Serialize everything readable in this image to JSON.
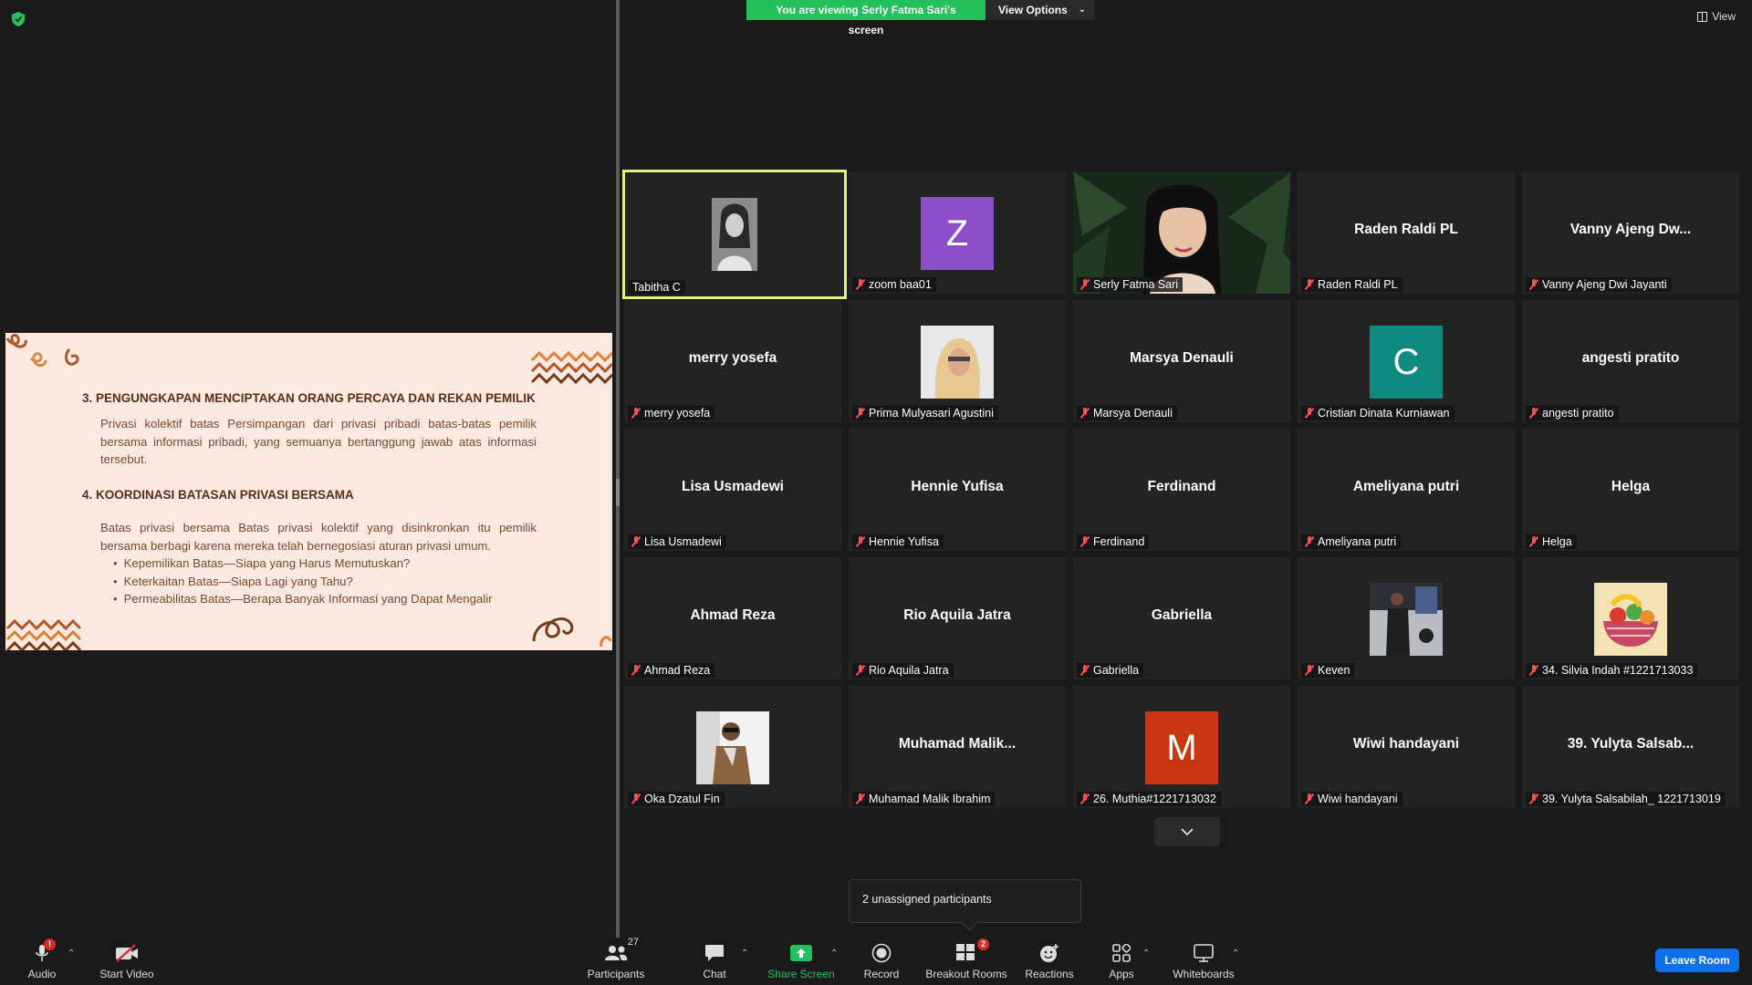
{
  "banner": {
    "viewing_text": "You are viewing Serly Fatma Sari's screen",
    "view_options_label": "View Options"
  },
  "top_right": {
    "view_label": "View"
  },
  "slide": {
    "item3_title": "3.  PENGUNGKAPAN MENCIPTAKAN ORANG PERCAYA DAN REKAN PEMILIK",
    "item3_body": "Privasi kolektif batas Persimpangan dari privasi pribadi batas-batas pemilik bersama informasi pribadi, yang semuanya bertanggung jawab atas informasi tersebut.",
    "item4_title": "4. KOORDINASI BATASAN PRIVASI BERSAMA",
    "item4_body": "Batas privasi bersama Batas privasi kolektif yang disinkronkan itu pemilik bersama berbagi karena mereka telah bernegosiasi aturan privasi umum.",
    "bullets": [
      "Kepemilikan Batas—Siapa yang Harus Memutuskan?",
      "Keterkaitan Batas—Siapa Lagi yang Tahu?",
      "Permeabilitas Batas—Berapa Banyak Informasi yang Dapat Mengalir"
    ]
  },
  "participants": [
    {
      "label": "Tabitha C",
      "display": "",
      "avatar": "photo-woman-bw",
      "muted": false,
      "active": true
    },
    {
      "label": "zoom baa01",
      "display": "",
      "avatar": "letter",
      "letter": "Z",
      "color": "#8c4fc9",
      "muted": true
    },
    {
      "label": "Serly Fatma Sari",
      "display": "",
      "avatar": "video",
      "muted": true
    },
    {
      "label": "Raden Raldi PL",
      "display": "Raden Raldi PL",
      "muted": true
    },
    {
      "label": "Vanny Ajeng Dwi Jayanti",
      "display": "Vanny  Ajeng  Dw...",
      "muted": true
    },
    {
      "label": "merry yosefa",
      "display": "merry yosefa",
      "muted": true
    },
    {
      "label": "Prima Mulyasari Agustini",
      "display": "",
      "avatar": "photo-hijab",
      "muted": true
    },
    {
      "label": "Marsya Denauli",
      "display": "Marsya Denauli",
      "muted": true
    },
    {
      "label": "Cristian Dinata Kurniawan",
      "display": "",
      "avatar": "letter",
      "letter": "C",
      "color": "#0f8a80",
      "muted": true
    },
    {
      "label": "angesti pratito",
      "display": "angesti pratito",
      "muted": true
    },
    {
      "label": "Lisa Usmadewi",
      "display": "Lisa Usmadewi",
      "muted": true
    },
    {
      "label": "Hennie Yufisa",
      "display": "Hennie Yufisa",
      "muted": true
    },
    {
      "label": "Ferdinand",
      "display": "Ferdinand",
      "muted": true
    },
    {
      "label": "Ameliyana putri",
      "display": "Ameliyana putri",
      "muted": true
    },
    {
      "label": "Helga",
      "display": "Helga",
      "muted": true
    },
    {
      "label": "Ahmad Reza",
      "display": "Ahmad Reza",
      "muted": true
    },
    {
      "label": "Rio Aquila Jatra",
      "display": "Rio Aquila Jatra",
      "muted": true
    },
    {
      "label": "Gabriella",
      "display": "Gabriella",
      "muted": true
    },
    {
      "label": "Keven",
      "display": "",
      "avatar": "photo-gym",
      "muted": true
    },
    {
      "label": "34. Silvia Indah #1221713033",
      "display": "",
      "avatar": "photo-fruit",
      "muted": true
    },
    {
      "label": "Oka Dzatul Fin",
      "display": "",
      "avatar": "photo-man",
      "muted": true
    },
    {
      "label": "Muhamad Malik Ibrahim",
      "display": "Muhamad  Malik...",
      "muted": true
    },
    {
      "label": "26. Muthia#1221713032",
      "display": "",
      "avatar": "letter",
      "letter": "M",
      "color": "#c9360f",
      "muted": true
    },
    {
      "label": "Wiwi handayani",
      "display": "Wiwi handayani",
      "muted": true
    },
    {
      "label": "39. Yulyta Salsabilah_ 1221713019",
      "display": "39.  Yulyta  Salsab...",
      "muted": true
    }
  ],
  "tooltip": {
    "text": "2 unassigned participants"
  },
  "toolbar": {
    "audio": "Audio",
    "audio_badge": "!",
    "start_video": "Start Video",
    "participants": "Participants",
    "participants_count": "27",
    "chat": "Chat",
    "share_screen": "Share Screen",
    "record": "Record",
    "breakout_rooms": "Breakout Rooms",
    "breakout_badge": "2",
    "reactions": "Reactions",
    "apps": "Apps",
    "whiteboards": "Whiteboards",
    "leave_room": "Leave Room"
  },
  "colors": {
    "banner_green": "#23c05b",
    "active_border": "#e4f17b",
    "leave_blue": "#0e71eb",
    "muted_red": "#ff5050",
    "slide_bg": "#fde9df"
  }
}
